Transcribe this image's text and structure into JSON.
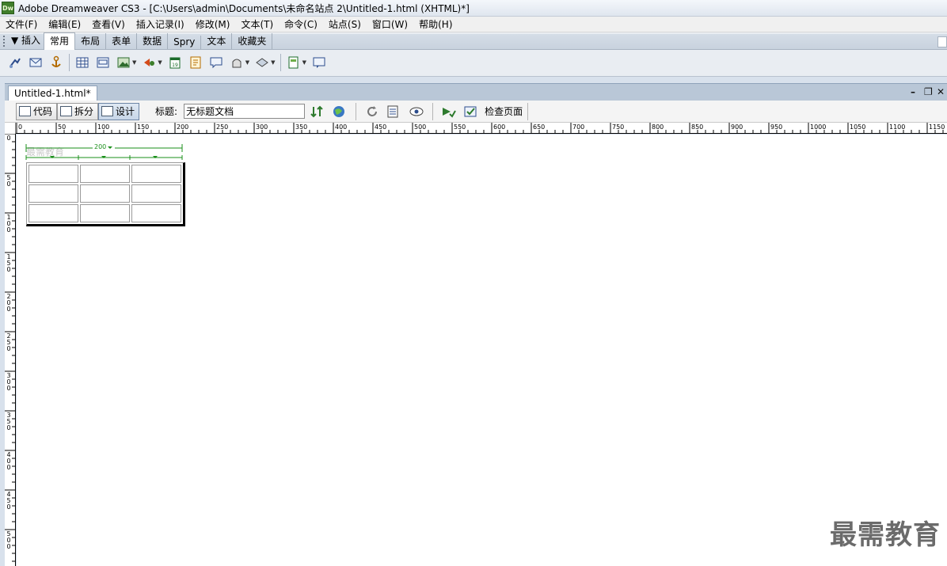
{
  "window": {
    "logo_text": "Dw",
    "title": "Adobe Dreamweaver CS3 - [C:\\Users\\admin\\Documents\\未命名站点 2\\Untitled-1.html (XHTML)*]"
  },
  "menu": {
    "items": [
      "文件(F)",
      "编辑(E)",
      "查看(V)",
      "插入记录(I)",
      "修改(M)",
      "文本(T)",
      "命令(C)",
      "站点(S)",
      "窗口(W)",
      "帮助(H)"
    ]
  },
  "insert_panel": {
    "label": "▼ 插入",
    "tabs": [
      "常用",
      "布局",
      "表单",
      "数据",
      "Spry",
      "文本",
      "收藏夹"
    ],
    "active_tab": "常用",
    "tools": [
      "hyperlink-icon",
      "email-link-icon",
      "named-anchor-icon",
      "table-icon",
      "div-icon",
      "image-icon",
      "media-icon",
      "date-icon",
      "server-include-icon",
      "comment-icon",
      "head-icon",
      "script-icon",
      "templates-icon",
      "tag-chooser-icon"
    ]
  },
  "document": {
    "tab_label": "Untitled-1.html*",
    "view_buttons": {
      "code": "代码",
      "split": "拆分",
      "design": "设计"
    },
    "active_view": "设计",
    "title_label": "标题:",
    "title_value": "无标题文档",
    "check_page_label": "检查页面"
  },
  "ruler": {
    "h_labels": [
      "0",
      "50",
      "100",
      "150",
      "200",
      "250",
      "300",
      "350",
      "400",
      "450",
      "500",
      "550",
      "600",
      "650",
      "700",
      "750",
      "800",
      "850",
      "900",
      "950",
      "1000",
      "1050",
      "1100",
      "1150"
    ],
    "v_labels": [
      "0",
      "50",
      "100",
      "150",
      "200",
      "250",
      "300",
      "350",
      "400",
      "450",
      "500"
    ]
  },
  "table": {
    "width_label": "200",
    "rows": 3,
    "cols": 3,
    "faint_text": "最需教育"
  },
  "watermark": "最需教育",
  "colors": {
    "green_indicator": "#1a8f1a",
    "panel": "#e9edf2"
  }
}
